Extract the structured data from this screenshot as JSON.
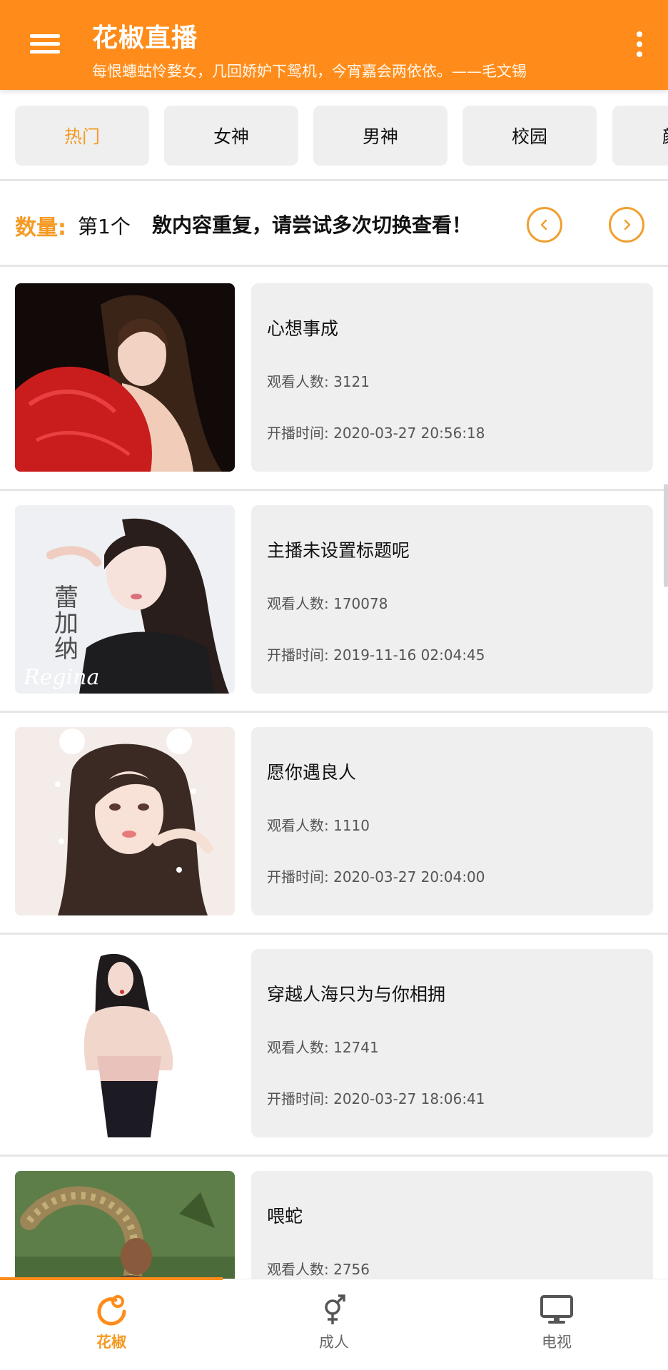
{
  "header": {
    "title": "花椒直播",
    "subtitle": "每恨蟪蛄怜婺女，几回娇妒下鸳机，今宵嘉会两依依。——毛文锡",
    "menu_icon": "hamburger-menu-icon",
    "more_icon": "more-vertical-icon"
  },
  "tabs": [
    {
      "label": "热门",
      "active": true
    },
    {
      "label": "女神",
      "active": false
    },
    {
      "label": "男神",
      "active": false
    },
    {
      "label": "校园",
      "active": false
    },
    {
      "label": "颜",
      "active": false
    }
  ],
  "count_bar": {
    "label": "数量:",
    "value": "第1个",
    "marquee": "敫内容重复，请尝试多次切换查看！",
    "prev_icon": "chevron-left-icon",
    "next_icon": "chevron-right-icon"
  },
  "streams": [
    {
      "title": "心想事成",
      "viewers": "观看人数: 3121",
      "start_time": "开播时间: 2020-03-27 20:56:18"
    },
    {
      "title": "主播未设置标题呢",
      "viewers": "观看人数: 170078",
      "start_time": "开播时间: 2019-11-16 02:04:45",
      "thumb_text": [
        "蕾",
        "加",
        "纳",
        "Regina"
      ]
    },
    {
      "title": "愿你遇良人",
      "viewers": "观看人数: 1110",
      "start_time": "开播时间: 2020-03-27 20:04:00"
    },
    {
      "title": "穿越人海只为与你相拥",
      "viewers": "观看人数: 12741",
      "start_time": "开播时间: 2020-03-27 18:06:41"
    },
    {
      "title": "喂蛇",
      "viewers": "观看人数: 2756",
      "start_time": ""
    }
  ],
  "bottom_nav": [
    {
      "label": "花椒",
      "icon": "huajiao-logo-icon",
      "active": true
    },
    {
      "label": "成人",
      "icon": "gender-symbol-icon",
      "active": false
    },
    {
      "label": "电视",
      "icon": "tv-monitor-icon",
      "active": false
    }
  ],
  "colors": {
    "accent": "#ff8c1a",
    "accent_text": "#f59a23",
    "card_bg": "#efefef"
  }
}
